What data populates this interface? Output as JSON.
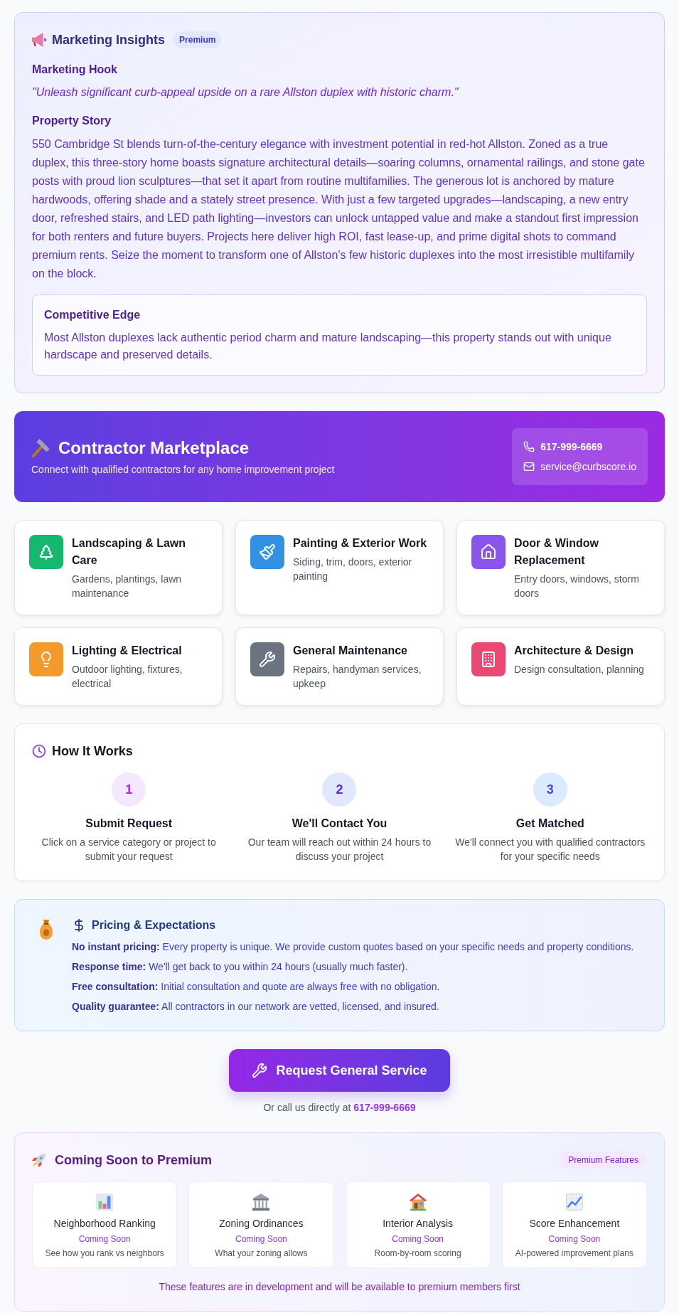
{
  "marketing_insights": {
    "title": "Marketing Insights",
    "badge": "Premium",
    "hook_heading": "Marketing Hook",
    "hook": "\"Unleash significant curb-appeal upside on a rare Allston duplex with historic charm.\"",
    "story_heading": "Property Story",
    "story": "550 Cambridge St blends turn-of-the-century elegance with investment potential in red-hot Allston. Zoned as a true duplex, this three-story home boasts signature architectural details—soaring columns, ornamental railings, and stone gate posts with proud lion sculptures—that set it apart from routine multifamilies. The generous lot is anchored by mature hardwoods, offering shade and a stately street presence. With just a few targeted upgrades—landscaping, a new entry door, refreshed stairs, and LED path lighting—investors can unlock untapped value and make a standout first impression for both renters and future buyers. Projects here deliver high ROI, fast lease-up, and prime digital shots to command premium rents. Seize the moment to transform one of Allston's few historic duplexes into the most irresistible multifamily on the block.",
    "competitive_edge": {
      "heading": "Competitive Edge",
      "text": "Most Allston duplexes lack authentic period charm and mature landscaping—this property stands out with unique hardscape and preserved details."
    }
  },
  "contractor_marketplace": {
    "title": "Contractor Marketplace",
    "subtitle": "Connect with qualified contractors for any home improvement project",
    "phone": "617-999-6669",
    "email": "service@curbscore.io"
  },
  "services": [
    {
      "title": "Landscaping & Lawn Care",
      "description": "Gardens, plantings, lawn maintenance",
      "color": "#14b86e"
    },
    {
      "title": "Painting & Exterior Work",
      "description": "Siding, trim, doors, exterior painting",
      "color": "#3391e3"
    },
    {
      "title": "Door & Window Replacement",
      "description": "Entry doors, windows, storm doors",
      "color": "#8a55ec"
    },
    {
      "title": "Lighting & Electrical",
      "description": "Outdoor lighting, fixtures, electrical",
      "color": "#f39a2c"
    },
    {
      "title": "General Maintenance",
      "description": "Repairs, handyman services, upkeep",
      "color": "#6b7280"
    },
    {
      "title": "Architecture & Design",
      "description": "Design consultation, planning",
      "color": "#ec4872"
    }
  ],
  "how_it_works": {
    "title": "How It Works",
    "steps": [
      {
        "number": "1",
        "title": "Submit Request",
        "description": "Click on a service category or project to submit your request",
        "color": "#f3e8ff"
      },
      {
        "number": "2",
        "title": "We'll Contact You",
        "description": "Our team will reach out within 24 hours to discuss your project",
        "color": "#e0e7ff"
      },
      {
        "number": "3",
        "title": "Get Matched",
        "description": "We'll connect you with qualified contractors for your specific needs",
        "color": "#dbeafe"
      }
    ]
  },
  "pricing": {
    "title": "Pricing & Expectations",
    "items": [
      "**No instant pricing:** Every property is unique. We provide custom quotes based on your specific needs and property conditions.",
      "**Response time:** We'll get back to you within 24 hours (usually much faster).",
      "**Free consultation:** Initial consultation and quote are always free with no obligation.",
      "**Quality guarantee:** All contractors in our network are vetted, licensed, and insured."
    ]
  },
  "request_button": {
    "label": "Request General Service"
  },
  "call_note": {
    "text": "Or call us directly at",
    "phone": "617-999-6669"
  },
  "coming_soon": {
    "title": "Coming Soon to Premium",
    "badge": "Premium Features",
    "features": [
      {
        "title": "Neighborhood Ranking",
        "status": "Coming Soon",
        "description": "See how you rank vs neighbors"
      },
      {
        "title": "Zoning Ordinances",
        "status": "Coming Soon",
        "description": "What your zoning allows"
      },
      {
        "title": "Interior Analysis",
        "status": "Coming Soon",
        "description": "Room-by-room scoring"
      },
      {
        "title": "Score Enhancement",
        "status": "Coming Soon",
        "description": "AI-powered improvement plans"
      }
    ],
    "footer": "These features are in development and will be available to premium members first"
  }
}
